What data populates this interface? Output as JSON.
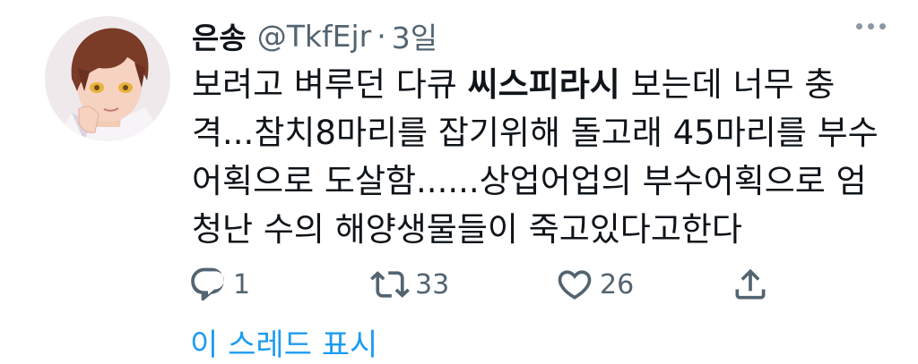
{
  "author": {
    "display_name": "은송",
    "handle": "@TkfEjr",
    "separator": "·",
    "time": "3일"
  },
  "tweet": {
    "lines": [
      {
        "pre": "보려고 벼루던 다큐 ",
        "bold": "씨스피라시",
        "post": " 보는데 너무 충"
      },
      {
        "pre": "격...참치8마리를 잡기위해 돌고래 45마리를 부수",
        "bold": "",
        "post": ""
      },
      {
        "pre": "어획으로 도살함......상업어업의 부수어획으로 엄",
        "bold": "",
        "post": ""
      },
      {
        "pre": "청난 수의 해양생물들이 죽고있다고한다",
        "bold": "",
        "post": ""
      }
    ]
  },
  "actions": {
    "reply_count": "1",
    "retweet_count": "33",
    "like_count": "26"
  },
  "thread_link": "이 스레드 표시",
  "colors": {
    "text": "#0f1419",
    "secondary": "#536471",
    "link": "#1d9bf0"
  },
  "icons": [
    "more-icon",
    "reply-icon",
    "retweet-icon",
    "like-icon",
    "share-icon"
  ]
}
